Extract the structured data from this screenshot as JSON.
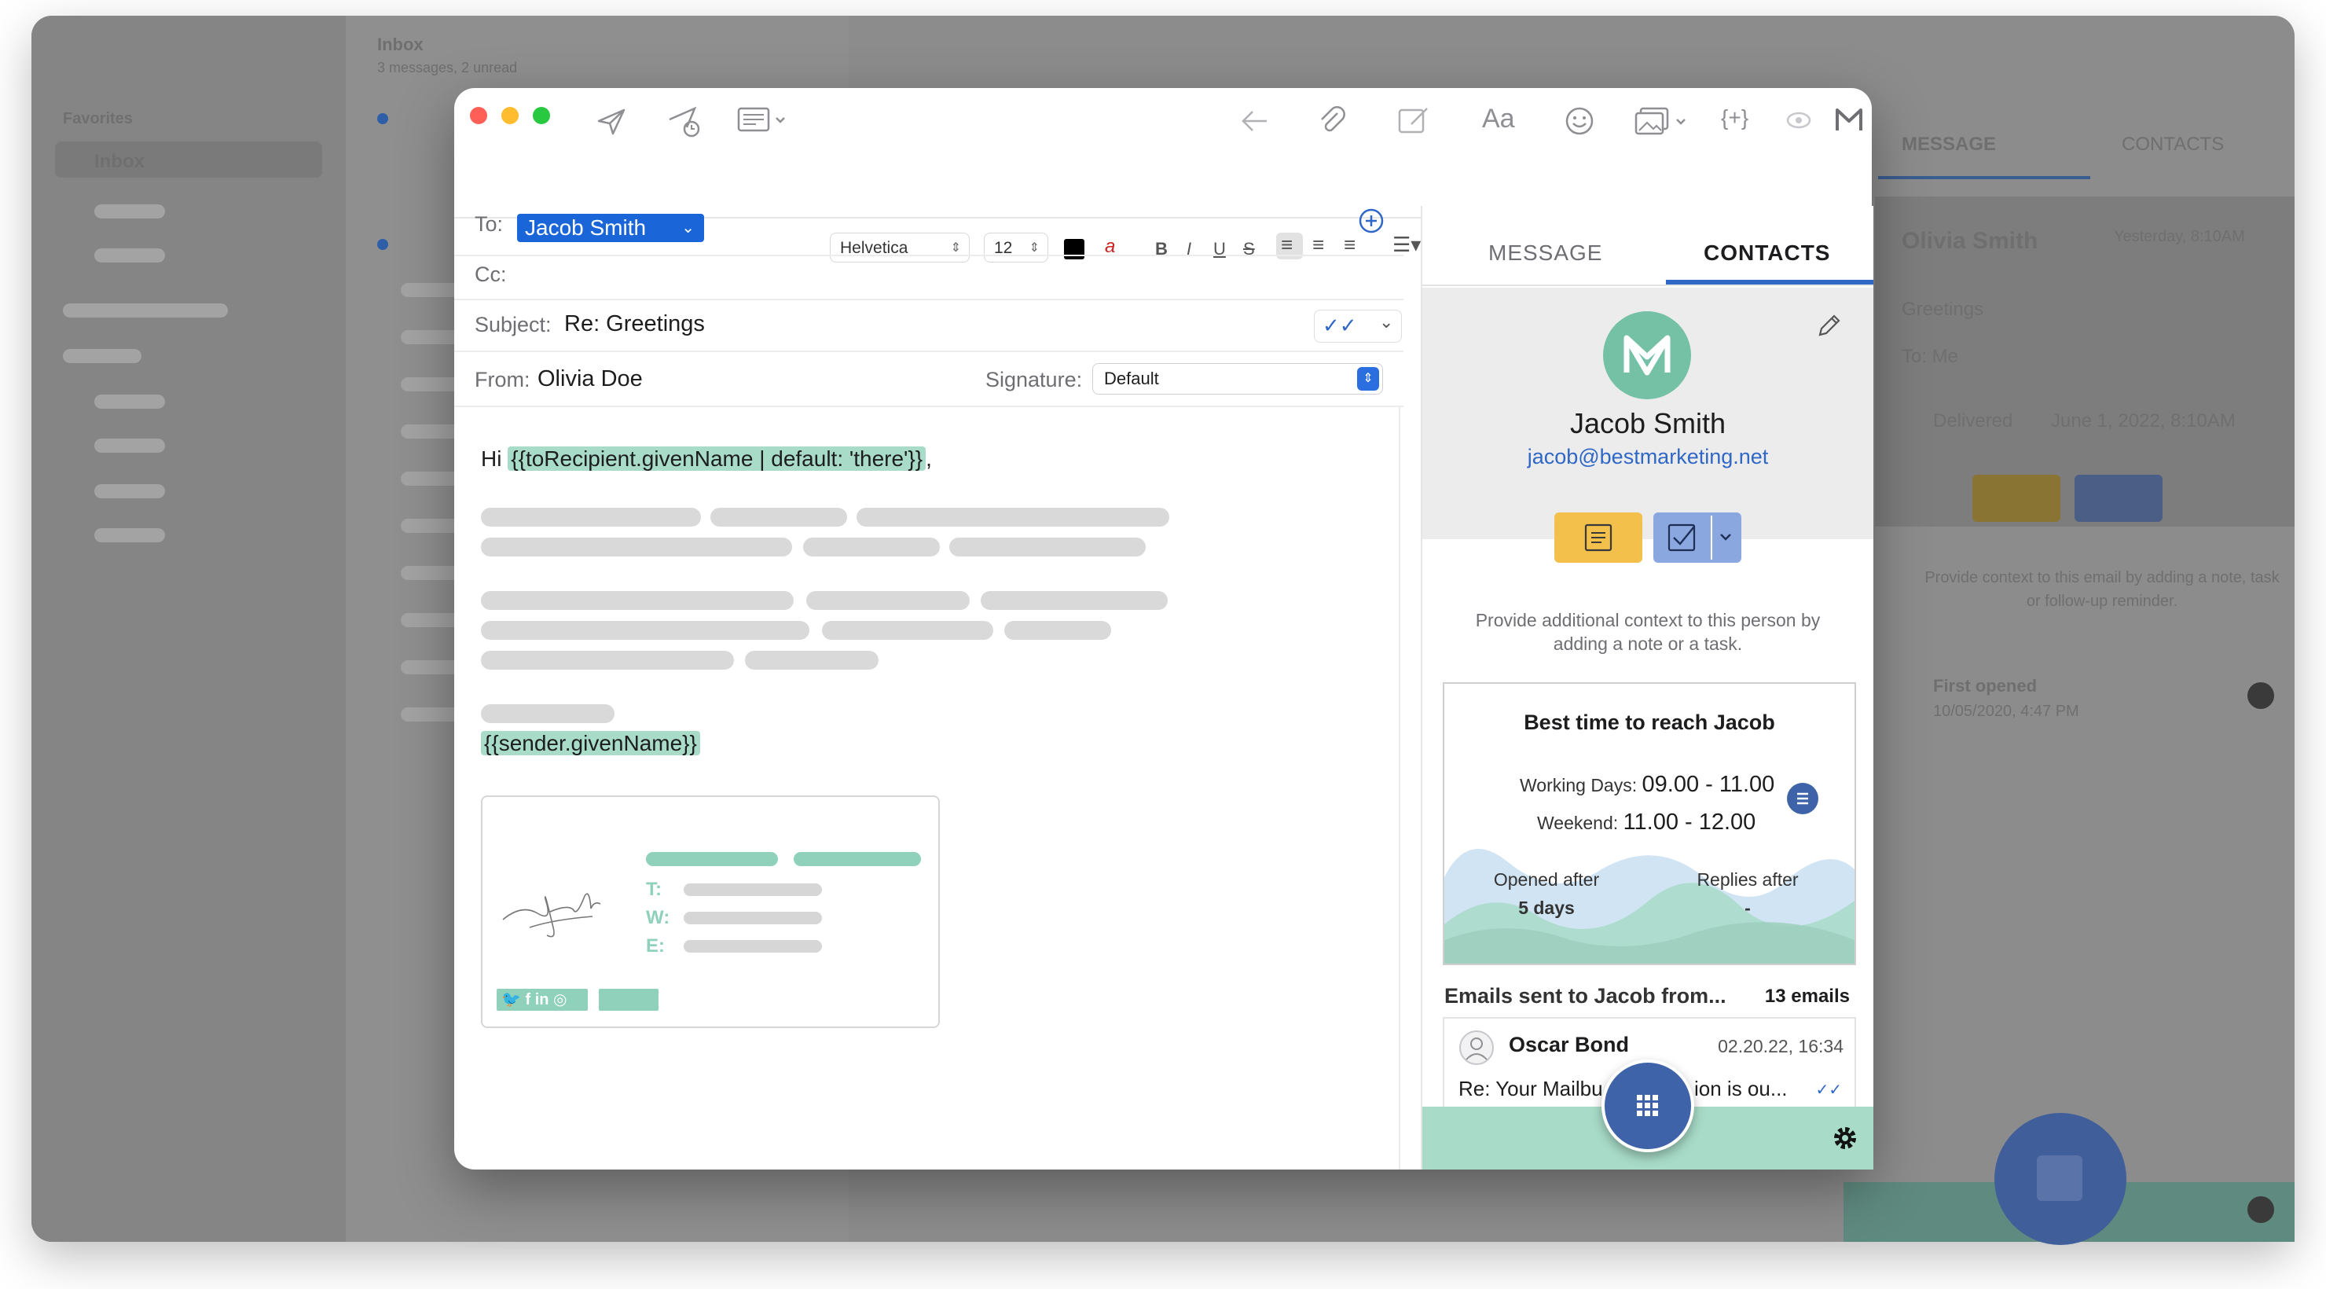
{
  "background_app": {
    "sidebar_heading": "Favorites",
    "inbox_label": "Inbox",
    "list_title": "Inbox",
    "list_subtitle": "3 messages, 2 unread",
    "tabs": [
      "MESSAGE",
      "CONTACTS"
    ],
    "preview_sender": "Olivia Smith",
    "preview_date": "Yesterday, 8:10AM",
    "preview_subject": "Greetings",
    "preview_to": "To: Me",
    "status_label": "Delivered",
    "status_date": "June 1, 2022, 8:10AM",
    "context_text": "Provide context to this email by adding a note, task or follow-up reminder.",
    "first_opened_label": "First opened",
    "first_opened_date": "10/05/2020, 4:47 PM"
  },
  "format_bar": {
    "font": "Helvetica",
    "size": "12"
  },
  "compose": {
    "to_label": "To:",
    "to_value": "Jacob Smith",
    "cc_label": "Cc:",
    "subject_label": "Subject:",
    "subject_value": "Re: Greetings",
    "from_label": "From:",
    "from_value": "Olivia Doe",
    "signature_label": "Signature:",
    "signature_value": "Default",
    "greeting_prefix": "Hi",
    "greeting_tag": "{{toRecipient.givenName | default: 'there'}}",
    "greeting_suffix": ",",
    "sender_tag": "{{sender.givenName}}",
    "sig_labels": [
      "T:",
      "W:",
      "E:"
    ]
  },
  "panel": {
    "tab_message": "MESSAGE",
    "tab_contacts": "CONTACTS",
    "contact_name": "Jacob Smith",
    "contact_email": "jacob@bestmarketing.net",
    "context_text": "Provide additional context to this person by adding a note or a task.",
    "best_time_title": "Best time to reach Jacob",
    "working_days_label": "Working Days:",
    "working_days_value": "09.00 - 11.00",
    "weekend_label": "Weekend:",
    "weekend_value": "11.00 - 12.00",
    "opened_after_label": "Opened after",
    "opened_after_value": "5 days",
    "replies_after_label": "Replies after",
    "replies_after_value": "-",
    "emails_heading": "Emails sent to Jacob from...",
    "emails_count": "13 emails",
    "email_sender": "Oscar Bond",
    "email_date": "02.20.22, 16:34",
    "email_subject_left": "Re: Your Mailbu",
    "email_subject_right": "ion is ou..."
  },
  "colors": {
    "accent_blue": "#1a66d9",
    "brand_green": "#74c1a5",
    "tag_green": "#a8dcc8",
    "note_yellow": "#f2c04b",
    "task_blue": "#8aa8df"
  }
}
